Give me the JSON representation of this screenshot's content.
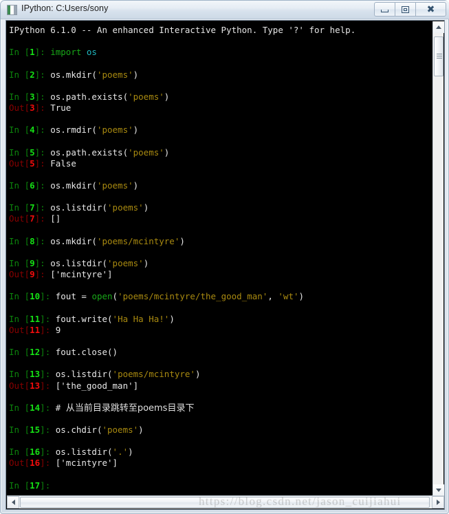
{
  "window": {
    "title": "IPython: C:Users/sony",
    "icon": "ipython-app-icon",
    "controls": {
      "minimize_label": "Minimize",
      "maximize_label": "Maximize",
      "close_label": "Close"
    }
  },
  "console": {
    "banner": "IPython 6.1.0 -- An enhanced Interactive Python. Type '?' for help.",
    "prompt_in": "In",
    "prompt_out": "Out",
    "entries": [
      {
        "number": "1",
        "code_parts": [
          {
            "t": "import",
            "c": "kw"
          },
          {
            "t": " ",
            "c": "code"
          },
          {
            "t": "os",
            "c": "mod"
          }
        ],
        "out": null
      },
      {
        "number": "2",
        "code_parts": [
          {
            "t": "os.mkdir(",
            "c": "code"
          },
          {
            "t": "'poems'",
            "c": "str"
          },
          {
            "t": ")",
            "c": "code"
          }
        ],
        "out": null
      },
      {
        "number": "3",
        "code_parts": [
          {
            "t": "os.path.exists(",
            "c": "code"
          },
          {
            "t": "'poems'",
            "c": "str"
          },
          {
            "t": ")",
            "c": "code"
          }
        ],
        "out": "True"
      },
      {
        "number": "4",
        "code_parts": [
          {
            "t": "os.rmdir(",
            "c": "code"
          },
          {
            "t": "'poems'",
            "c": "str"
          },
          {
            "t": ")",
            "c": "code"
          }
        ],
        "out": null
      },
      {
        "number": "5",
        "code_parts": [
          {
            "t": "os.path.exists(",
            "c": "code"
          },
          {
            "t": "'poems'",
            "c": "str"
          },
          {
            "t": ")",
            "c": "code"
          }
        ],
        "out": "False"
      },
      {
        "number": "6",
        "code_parts": [
          {
            "t": "os.mkdir(",
            "c": "code"
          },
          {
            "t": "'poems'",
            "c": "str"
          },
          {
            "t": ")",
            "c": "code"
          }
        ],
        "out": null
      },
      {
        "number": "7",
        "code_parts": [
          {
            "t": "os.listdir(",
            "c": "code"
          },
          {
            "t": "'poems'",
            "c": "str"
          },
          {
            "t": ")",
            "c": "code"
          }
        ],
        "out": "[]"
      },
      {
        "number": "8",
        "code_parts": [
          {
            "t": "os.mkdir(",
            "c": "code"
          },
          {
            "t": "'poems/mcintyre'",
            "c": "str"
          },
          {
            "t": ")",
            "c": "code"
          }
        ],
        "out": null
      },
      {
        "number": "9",
        "code_parts": [
          {
            "t": "os.listdir(",
            "c": "code"
          },
          {
            "t": "'poems'",
            "c": "str"
          },
          {
            "t": ")",
            "c": "code"
          }
        ],
        "out": "['mcintyre']"
      },
      {
        "number": "10",
        "code_parts": [
          {
            "t": "fout = ",
            "c": "code"
          },
          {
            "t": "open",
            "c": "fn"
          },
          {
            "t": "(",
            "c": "code"
          },
          {
            "t": "'poems/mcintyre/the_good_man'",
            "c": "str"
          },
          {
            "t": ", ",
            "c": "code"
          },
          {
            "t": "'wt'",
            "c": "str"
          },
          {
            "t": ")",
            "c": "code"
          }
        ],
        "out": null
      },
      {
        "number": "11",
        "code_parts": [
          {
            "t": "fout.write(",
            "c": "code"
          },
          {
            "t": "'Ha Ha Ha!'",
            "c": "str"
          },
          {
            "t": ")",
            "c": "code"
          }
        ],
        "out": "9"
      },
      {
        "number": "12",
        "code_parts": [
          {
            "t": "fout.close()",
            "c": "code"
          }
        ],
        "out": null
      },
      {
        "number": "13",
        "code_parts": [
          {
            "t": "os.listdir(",
            "c": "code"
          },
          {
            "t": "'poems/mcintyre'",
            "c": "str"
          },
          {
            "t": ")",
            "c": "code"
          }
        ],
        "out": "['the_good_man']"
      },
      {
        "number": "14",
        "code_parts": [
          {
            "t": "# ",
            "c": "comment"
          },
          {
            "t": "从当前目录跳转至poems目录下",
            "c": "comment cjk"
          }
        ],
        "out": null
      },
      {
        "number": "15",
        "code_parts": [
          {
            "t": "os.chdir(",
            "c": "code"
          },
          {
            "t": "'poems'",
            "c": "str"
          },
          {
            "t": ")",
            "c": "code"
          }
        ],
        "out": null
      },
      {
        "number": "16",
        "code_parts": [
          {
            "t": "os.listdir(",
            "c": "code"
          },
          {
            "t": "'.'",
            "c": "str"
          },
          {
            "t": ")",
            "c": "code"
          }
        ],
        "out": "['mcintyre']"
      },
      {
        "number": "17",
        "code_parts": [],
        "out": null
      }
    ]
  },
  "watermark": "https://blog.csdn.net/jason_cuijiahui",
  "colors": {
    "console_background": "#000000",
    "prompt_in": "#0c860c",
    "prompt_in_number": "#15e015",
    "prompt_out": "#8a0000",
    "prompt_out_number": "#f20c0c",
    "code_text": "#e8e8e8",
    "string": "#a98a10",
    "keyword": "#18a818",
    "module": "#1fb8c0",
    "titlebar": "#dfe7ef"
  }
}
